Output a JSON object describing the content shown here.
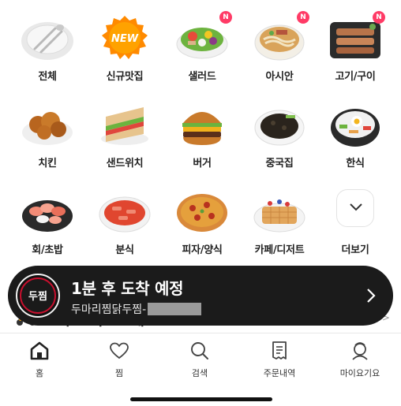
{
  "categories": [
    {
      "label": "전체",
      "icon": "plate-utensils-icon",
      "badge": ""
    },
    {
      "label": "신규맛집",
      "icon": "new-badge-icon",
      "badge": "",
      "image_text": "NEW"
    },
    {
      "label": "샐러드",
      "icon": "salad-icon",
      "badge": "N"
    },
    {
      "label": "아시안",
      "icon": "noodle-soup-icon",
      "badge": "N"
    },
    {
      "label": "고기/구이",
      "icon": "grilled-meat-icon",
      "badge": "N"
    },
    {
      "label": "치킨",
      "icon": "fried-chicken-icon",
      "badge": ""
    },
    {
      "label": "샌드위치",
      "icon": "sandwich-icon",
      "badge": ""
    },
    {
      "label": "버거",
      "icon": "burger-icon",
      "badge": ""
    },
    {
      "label": "중국집",
      "icon": "black-bean-noodles-icon",
      "badge": ""
    },
    {
      "label": "한식",
      "icon": "bibimbap-icon",
      "badge": ""
    },
    {
      "label": "회/초밥",
      "icon": "sashimi-icon",
      "badge": ""
    },
    {
      "label": "분식",
      "icon": "tteokbokki-icon",
      "badge": ""
    },
    {
      "label": "피자/양식",
      "icon": "pizza-icon",
      "badge": ""
    },
    {
      "label": "카페/디저트",
      "icon": "waffle-icon",
      "badge": ""
    },
    {
      "label": "더보기",
      "icon": "chevron-down-icon",
      "badge": ""
    }
  ],
  "express": {
    "title": "요기요 익스프레스",
    "more": "더보기 >"
  },
  "banner": {
    "title": "1분 후 도착 예정",
    "subtitle": "두마리찜닭두찜-",
    "logo_text": "두찜"
  },
  "tabs": [
    {
      "label": "홈",
      "icon": "home-icon",
      "active": true
    },
    {
      "label": "찜",
      "icon": "heart-icon",
      "active": false
    },
    {
      "label": "검색",
      "icon": "search-icon",
      "active": false
    },
    {
      "label": "주문내역",
      "icon": "receipt-icon",
      "active": false
    },
    {
      "label": "마이요기요",
      "icon": "profile-icon",
      "active": false
    }
  ],
  "colors": {
    "badge": "#ff3b66",
    "banner_bg": "#1b1b1b",
    "new_badge": "#ff8a00"
  }
}
